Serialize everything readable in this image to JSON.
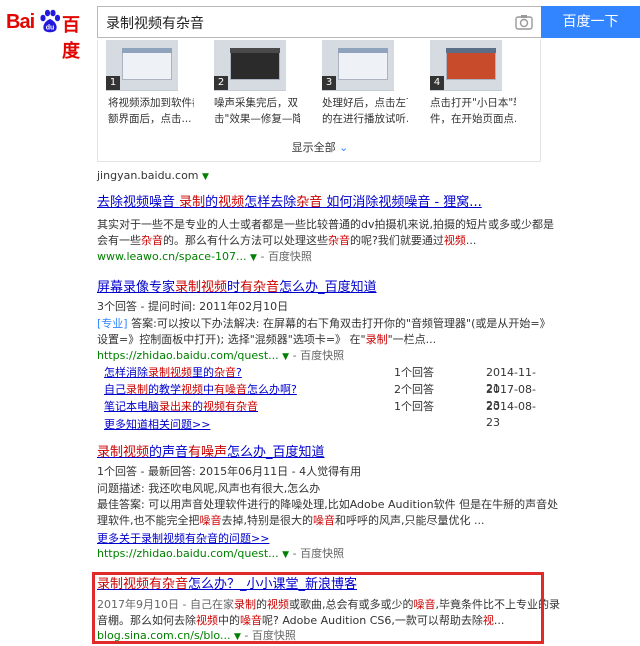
{
  "header": {
    "logo_bai": "Bai",
    "logo_du": "百度",
    "query": "录制视频有杂音",
    "search_button": "百度一下"
  },
  "steps_card": {
    "steps": [
      {
        "num": "1",
        "text_line1": "将视频添加到软件都",
        "text_line2": "额界面后，点击..."
      },
      {
        "num": "2",
        "text_line1": "噪声采集完后，双",
        "text_line2": "击\"效果—修复—降噪..."
      },
      {
        "num": "3",
        "text_line1": "处理好后，点击左下角",
        "text_line2": "的在进行播放试听..."
      },
      {
        "num": "4",
        "text_line1": "点击打开\"小日本\"软",
        "text_line2": "件，在开始页面点..."
      }
    ],
    "show_all": "显示全部",
    "source": "jingyan.baidu.com"
  },
  "results": [
    {
      "title_parts": [
        "去除视频噪音 ",
        "录制",
        "的",
        "视频",
        "怎样去除",
        "杂音",
        " 如何消除视频噪音 - 狸窝..."
      ],
      "snippet1_parts": [
        "其实对于一些不是专业的人士或者都是一些比较普通的dv拍摄机来说,拍摄的短片或多或少都是"
      ],
      "snippet2_parts": [
        "会有一些",
        "杂音",
        "的。那么有什么方法可以处理这些",
        "杂音",
        "的呢?我们就要通过",
        "视频",
        "..."
      ],
      "url": "www.leawo.cn/space-107...",
      "snapshot": "百度快照"
    },
    {
      "title_parts": [
        "屏幕录像专家",
        "录制视频",
        "时",
        "有杂音",
        "怎么办_百度知道"
      ],
      "meta": "3个回答 - 提问时间: 2011年02月10日",
      "snippet1_tag": "[专业]",
      "snippet1": " 答案:可以按以下办法解决: 在屏幕的右下角双击打开你的\"音频管理器\"(或是从开始=》",
      "snippet2_parts": [
        "设置=》控制面板中打开); 选择\"混频器\"选项卡=》 在\"",
        "录制",
        "\"一栏点..."
      ],
      "url": "https://zhidao.baidu.com/quest...",
      "snapshot": "百度快照",
      "related": [
        {
          "q_parts": [
            "怎样消除",
            "录制视频",
            "里的",
            "杂音",
            "?"
          ],
          "count": "1个回答",
          "date": "2014-11-21"
        },
        {
          "q_parts": [
            "自己",
            "录制",
            "的教学",
            "视频",
            "中",
            "有噪音",
            "怎么办啊?"
          ],
          "count": "2个回答",
          "date": "2017-08-23"
        },
        {
          "q_parts": [
            "笔记本电脑",
            "录出来",
            "的",
            "视频有杂音"
          ],
          "count": "1个回答",
          "date": "2014-08-23"
        }
      ],
      "more": "更多知道相关问题>>"
    },
    {
      "title_parts": [
        "录制视频",
        "的声音",
        "有噪声",
        "怎么办_百度知道"
      ],
      "meta": "1个回答 - 最新回答: 2015年06月11日 - 4人觉得有用",
      "desc": "问题描述: 我还吹电风呢,风声也有很大,怎么办",
      "snippet1": "最佳答案: 可以用声音处理软件进行的降噪处理,比如Adobe Audition软件 但是在牛掰的声音处",
      "snippet2_parts": [
        "理软件,也不能完全把",
        "噪音",
        "去掉,特别是很大的",
        "噪音",
        "和呼呼的风声,只能尽量优化 ..."
      ],
      "more": "更多关于录制视频有杂音的问题>>",
      "url": "https://zhidao.baidu.com/quest...",
      "snapshot": "百度快照"
    },
    {
      "title_parts": [
        "录制视频有杂音",
        "怎么办？_小小课堂_新浪博客"
      ],
      "snippet1_parts": [
        "2017年9月10日 - 自己在家",
        "录制",
        "的",
        "视频",
        "或歌曲,总会有或多或少的",
        "噪音",
        ",毕竟条件比不上专业的录"
      ],
      "snippet2_parts": [
        "音棚。那么如何去除",
        "视频",
        "中的",
        "噪音",
        "呢? Adobe Audition CS6,一款可以帮助去除",
        "视",
        "..."
      ],
      "url": "blog.sina.com.cn/s/blo...",
      "snapshot": "百度快照"
    }
  ],
  "colors": {
    "accent": "#3385ff",
    "link": "#0000cc",
    "highlight": "#c00",
    "url": "#008000",
    "annotation_box": "#e12a2a"
  }
}
